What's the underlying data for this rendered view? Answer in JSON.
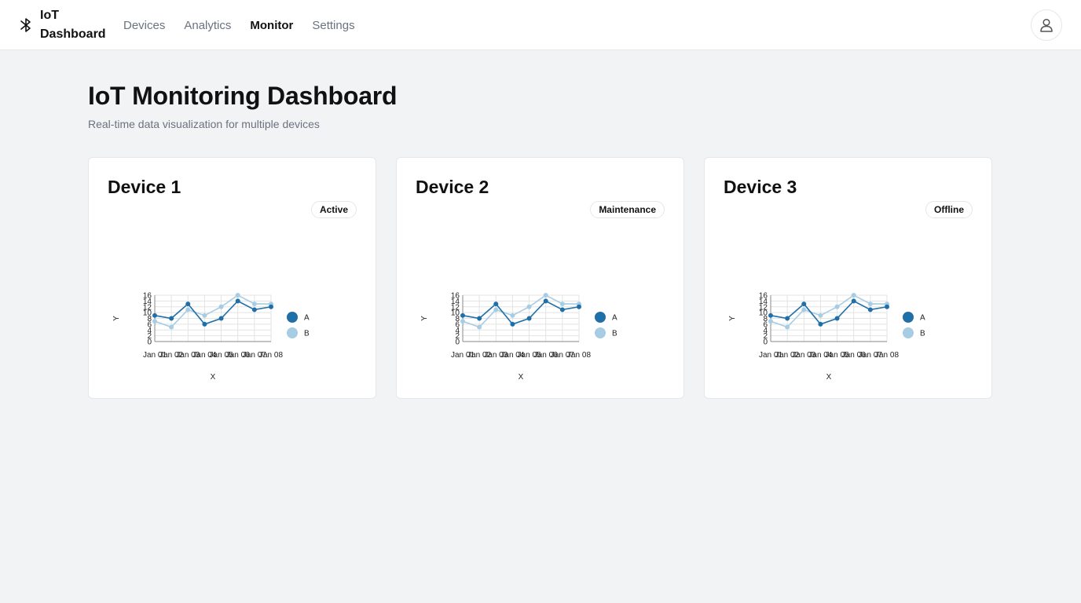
{
  "header": {
    "brand_line1": "IoT",
    "brand_line2": "Dashboard",
    "brand_icon": "bluetooth-icon",
    "nav": [
      "Devices",
      "Analytics",
      "Monitor",
      "Settings"
    ],
    "active_nav": "Monitor",
    "user_icon": "user-icon"
  },
  "page": {
    "title": "IoT Monitoring Dashboard",
    "subtitle": "Real-time data visualization for multiple devices"
  },
  "devices": [
    {
      "name": "Device 1",
      "status": "Active"
    },
    {
      "name": "Device 2",
      "status": "Maintenance"
    },
    {
      "name": "Device 3",
      "status": "Offline"
    }
  ],
  "colors": {
    "series_a": "#1f6fa8",
    "series_b": "#a6cde3"
  },
  "chart_data": [
    {
      "type": "line",
      "x": [
        "Jan 01",
        "Jan 02",
        "Jan 03",
        "Jan 04",
        "Jan 05",
        "Jan 06",
        "Jan 07",
        "Jan 08"
      ],
      "series": [
        {
          "name": "A",
          "values": [
            9,
            8,
            13,
            6,
            8,
            14,
            11,
            12
          ]
        },
        {
          "name": "B",
          "values": [
            7,
            5,
            11,
            9,
            12,
            16,
            13,
            13
          ]
        }
      ],
      "xlabel": "X",
      "ylabel": "Y",
      "ylim": [
        0,
        16
      ],
      "yticks": [
        0,
        2,
        4,
        6,
        8,
        10,
        12,
        14,
        16
      ],
      "grid": true,
      "legend": "right"
    },
    {
      "type": "line",
      "x": [
        "Jan 01",
        "Jan 02",
        "Jan 03",
        "Jan 04",
        "Jan 05",
        "Jan 06",
        "Jan 07",
        "Jan 08"
      ],
      "series": [
        {
          "name": "A",
          "values": [
            9,
            8,
            13,
            6,
            8,
            14,
            11,
            12
          ]
        },
        {
          "name": "B",
          "values": [
            7,
            5,
            11,
            9,
            12,
            16,
            13,
            13
          ]
        }
      ],
      "xlabel": "X",
      "ylabel": "Y",
      "ylim": [
        0,
        16
      ],
      "yticks": [
        0,
        2,
        4,
        6,
        8,
        10,
        12,
        14,
        16
      ],
      "grid": true,
      "legend": "right"
    },
    {
      "type": "line",
      "x": [
        "Jan 01",
        "Jan 02",
        "Jan 03",
        "Jan 04",
        "Jan 05",
        "Jan 06",
        "Jan 07",
        "Jan 08"
      ],
      "series": [
        {
          "name": "A",
          "values": [
            9,
            8,
            13,
            6,
            8,
            14,
            11,
            12
          ]
        },
        {
          "name": "B",
          "values": [
            7,
            5,
            11,
            9,
            12,
            16,
            13,
            13
          ]
        }
      ],
      "xlabel": "X",
      "ylabel": "Y",
      "ylim": [
        0,
        16
      ],
      "yticks": [
        0,
        2,
        4,
        6,
        8,
        10,
        12,
        14,
        16
      ],
      "grid": true,
      "legend": "right"
    }
  ]
}
